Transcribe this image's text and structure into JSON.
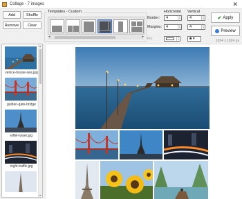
{
  "window": {
    "title": "Collage - 7 images",
    "close_glyph": "✕"
  },
  "left_buttons": {
    "add": "Add",
    "shuffle": "Shuffle",
    "remove": "Remove",
    "clear": "Clear"
  },
  "templates": {
    "label": "Templates - Custom"
  },
  "controls": {
    "horizontal_label": "Horizontal",
    "vertical_label": "Vertical",
    "border_label": "Border:",
    "margin_label": "Margins:",
    "border_h": "4",
    "border_v": "4",
    "margin_h": "4",
    "margin_v": "4",
    "third_label": "Fit:",
    "color_value": "",
    "size_value": "■ ▾"
  },
  "actions": {
    "apply": "Apply",
    "preview": "Preview"
  },
  "canvas_info": {
    "dimensions": "1024 x 1024 px"
  },
  "images": [
    {
      "caption": "venice-house-sea.jpg"
    },
    {
      "caption": "golden-gate-bridge"
    },
    {
      "caption": "eiffel-tower.jpg"
    },
    {
      "caption": "night-traffic.jpg"
    }
  ],
  "colors": {
    "accent": "#3d6ec9",
    "apply_green": "#2a9d2a"
  }
}
